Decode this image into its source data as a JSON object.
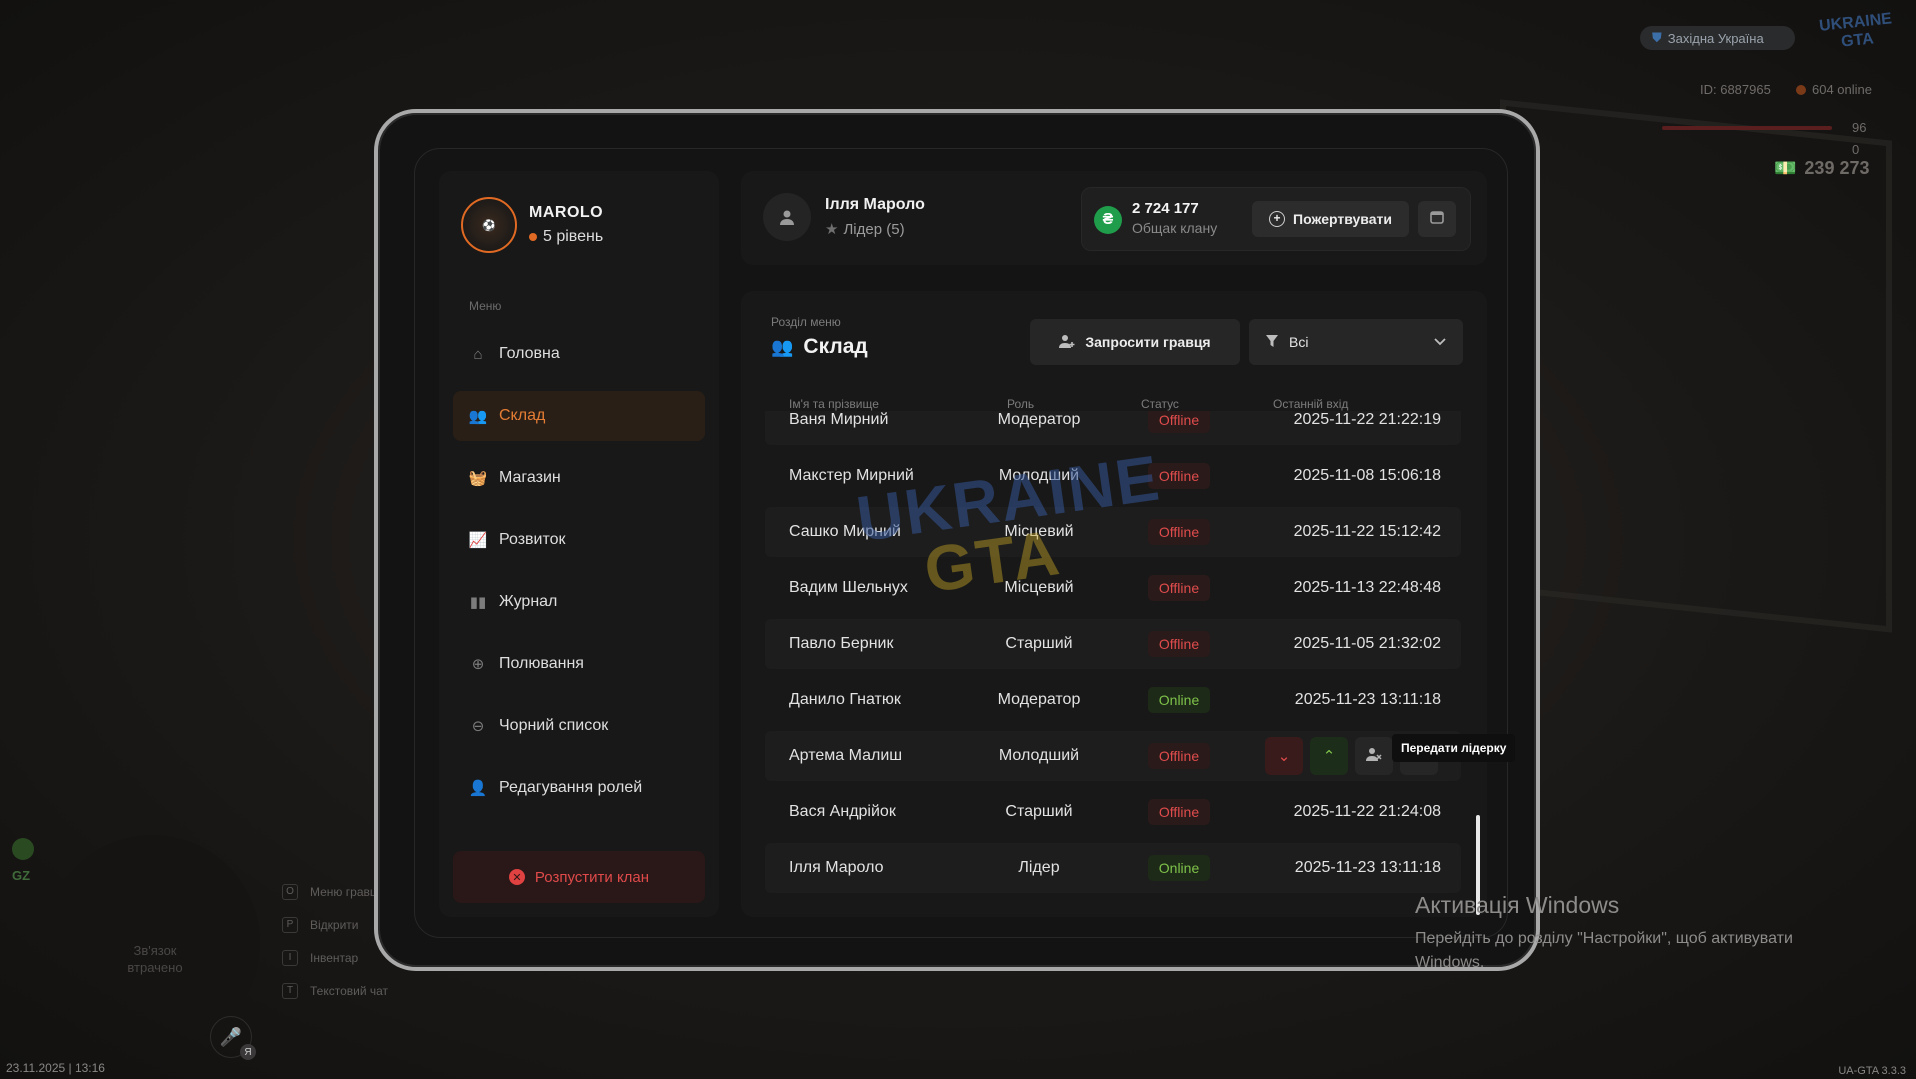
{
  "hud": {
    "region": "Західна Україна",
    "logo": "UKRAINE GTA",
    "id_label": "ID: 6887965",
    "online": "604 online",
    "health": "96",
    "armor": "0",
    "money": "239 273",
    "date": "23.11.2025 | 13:16",
    "version": "UA-GTA 3.3.3",
    "gz_label": "GZ",
    "connection_lost": "Зв'язок втрачено",
    "mic_badge": "Я",
    "hotkeys": [
      {
        "key": "O",
        "label": "Меню гравця"
      },
      {
        "key": "P",
        "label": "Відкрити"
      },
      {
        "key": "I",
        "label": "Інвентар"
      },
      {
        "key": "T",
        "label": "Текстовий чат"
      }
    ]
  },
  "windows_activation": {
    "title": "Активація Windows",
    "text": "Перейдіть до розділу \"Настройки\", щоб активувати Windows."
  },
  "sidebar": {
    "clan_name": "MAROLO",
    "clan_level": "5 рівень",
    "menu_caption": "Меню",
    "items": [
      {
        "label": "Головна",
        "icon": "home-icon"
      },
      {
        "label": "Склад",
        "icon": "members-icon",
        "active": true
      },
      {
        "label": "Магазин",
        "icon": "basket-icon"
      },
      {
        "label": "Розвиток",
        "icon": "chart-icon"
      },
      {
        "label": "Журнал",
        "icon": "book-icon"
      },
      {
        "label": "Полювання",
        "icon": "crosshair-icon"
      },
      {
        "label": "Чорний список",
        "icon": "ban-icon"
      },
      {
        "label": "Редагування ролей",
        "icon": "user-gear-icon"
      }
    ],
    "disband_label": "Розпустити клан"
  },
  "top": {
    "user_name": "Ілля Мароло",
    "user_role": "Лідер (5)",
    "bank_amount": "2 724 177",
    "bank_label": "Общак клану",
    "donate_label": "Пожертвувати"
  },
  "panel": {
    "caption": "Розділ меню",
    "title": "Склад",
    "invite_label": "Запросити гравця",
    "filter_value": "Всі",
    "columns": [
      "Ім'я та прізвище",
      "Роль",
      "Статус",
      "Останній вхід"
    ],
    "rows": [
      {
        "name": "Ваня Мирний",
        "role": "Модератор",
        "status": "Offline",
        "last": "2025-11-22 21:22:19"
      },
      {
        "name": "Макстер Мирний",
        "role": "Молодший",
        "status": "Offline",
        "last": "2025-11-08 15:06:18"
      },
      {
        "name": "Сашко Мирний",
        "role": "Місцевий",
        "status": "Offline",
        "last": "2025-11-22 15:12:42"
      },
      {
        "name": "Вадим Шельнух",
        "role": "Місцевий",
        "status": "Offline",
        "last": "2025-11-13 22:48:48"
      },
      {
        "name": "Павло Берник",
        "role": "Старший",
        "status": "Offline",
        "last": "2025-11-05 21:32:02"
      },
      {
        "name": "Данило Гнатюк",
        "role": "Модератор",
        "status": "Online",
        "last": "2025-11-23 13:11:18"
      },
      {
        "name": "Артема Малиш",
        "role": "Молодший",
        "status": "Offline",
        "last": ""
      },
      {
        "name": "Вася Андрійок",
        "role": "Старший",
        "status": "Offline",
        "last": "2025-11-22 21:24:08"
      },
      {
        "name": "Ілля Мароло",
        "role": "Лідер",
        "status": "Online",
        "last": "2025-11-23 13:11:18"
      }
    ],
    "tooltip": "Передати лідерку"
  },
  "colors": {
    "accent": "#e57d34",
    "offline": "#e04c4c",
    "online": "#7ec24a",
    "bank_coin": "#1f9d4a"
  }
}
